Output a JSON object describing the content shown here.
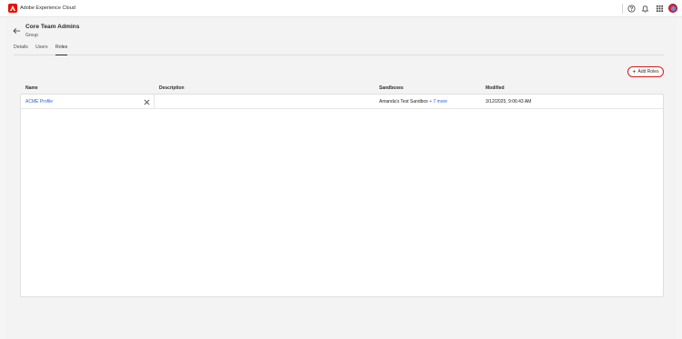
{
  "app": {
    "title": "Adobe Experience Cloud"
  },
  "header": {
    "title": "Core Team Admins",
    "subtitle": "Group"
  },
  "tabs": [
    {
      "label": "Details"
    },
    {
      "label": "Users"
    },
    {
      "label": "Roles",
      "active": true
    }
  ],
  "toolbar": {
    "add_roles_label": "Add Roles"
  },
  "table": {
    "columns": [
      "Name",
      "Description",
      "Sandboxes",
      "Modified"
    ],
    "rows": [
      {
        "name": "ACME Profile",
        "description": "",
        "sandboxes": "Amanda's Test Sandbox",
        "sandboxes_more": "+ 7 more",
        "modified": "3/12/2025, 9:06:43 AM"
      }
    ]
  },
  "colors": {
    "brand": "#eb1000",
    "link": "#2c5fd1",
    "highlight": "#d7191c"
  }
}
